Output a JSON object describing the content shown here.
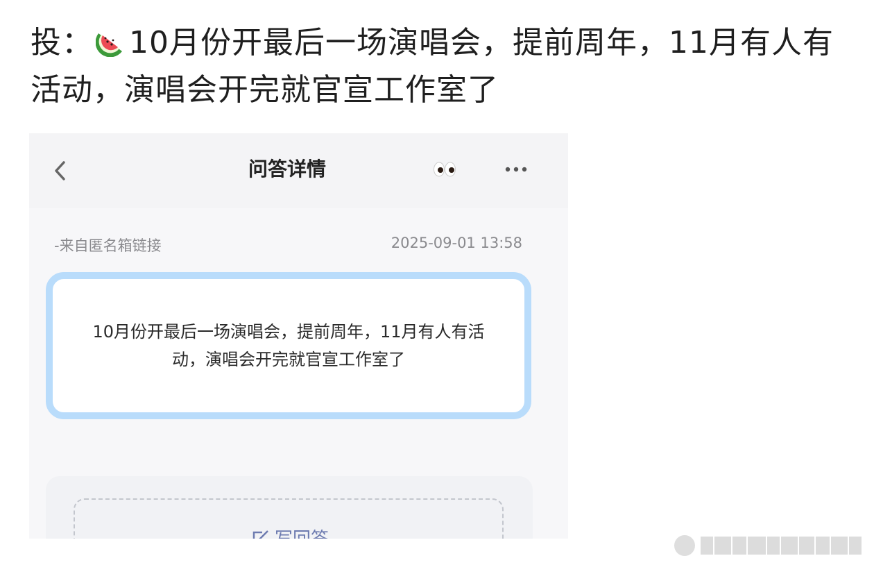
{
  "post": {
    "prefix": "投：",
    "emoji_icon": "watermelon-icon",
    "body": "10月份开最后一场演唱会，提前周年，11月有人有活动，演唱会开完就官宣工作室了"
  },
  "screenshot": {
    "header": {
      "back_icon": "chevron-left-icon",
      "title": "问答详情",
      "eyes_icon": "eyes-icon",
      "more_icon": "more-dots-icon"
    },
    "meta": {
      "source": "-来自匿名箱链接",
      "timestamp": "2025-09-01 13:58"
    },
    "question": {
      "text": "10月份开最后一场演唱会，提前周年，11月有人有活动，演唱会开完就官宣工作室了"
    },
    "answer": {
      "icon": "edit-icon",
      "label": "写回答"
    }
  },
  "colors": {
    "card_border": "#b9dcfb",
    "answer_accent": "#6d7bb0"
  }
}
